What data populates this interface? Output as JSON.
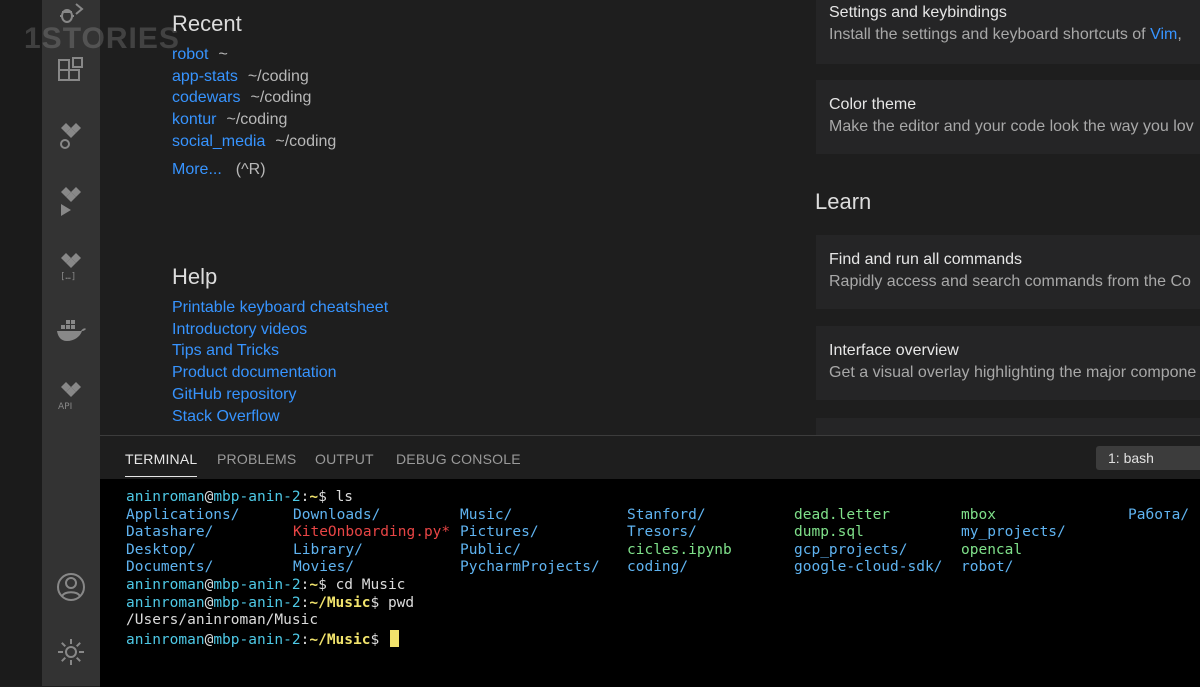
{
  "watermark": "1STORIES",
  "recent": {
    "title": "Recent",
    "items": [
      {
        "name": "robot",
        "path": "~"
      },
      {
        "name": "app-stats",
        "path": "~/coding"
      },
      {
        "name": "codewars",
        "path": "~/coding"
      },
      {
        "name": "kontur",
        "path": "~/coding"
      },
      {
        "name": "social_media",
        "path": "~/coding"
      }
    ],
    "more_label": "More...",
    "more_hint": "(^R)"
  },
  "help": {
    "title": "Help",
    "links": [
      "Printable keyboard cheatsheet",
      "Introductory videos",
      "Tips and Tricks",
      "Product documentation",
      "GitHub repository",
      "Stack Overflow"
    ]
  },
  "customize": {
    "cards": [
      {
        "title": "Settings and keybindings",
        "desc": "Install the settings and keyboard shortcuts of ",
        "link": "Vim",
        "after": ","
      },
      {
        "title": "Color theme",
        "desc": "Make the editor and your code look the way you lov"
      }
    ]
  },
  "learn": {
    "title": "Learn",
    "cards": [
      {
        "title": "Find and run all commands",
        "desc": "Rapidly access and search commands from the Co"
      },
      {
        "title": "Interface overview",
        "desc": "Get a visual overlay highlighting the major compone"
      }
    ]
  },
  "panel": {
    "tabs": [
      "TERMINAL",
      "PROBLEMS",
      "OUTPUT",
      "DEBUG CONSOLE"
    ],
    "active_tab": "TERMINAL",
    "shell": "1: bash"
  },
  "terminal": {
    "user": "aninroman",
    "host": "mbp-anin-2",
    "prompts": [
      {
        "path": "~",
        "cmd": "ls"
      },
      {
        "path": "~",
        "cmd": "cd Music"
      },
      {
        "path": "~/Music",
        "cmd": "pwd"
      },
      {
        "path": "~/Music",
        "cmd": ""
      }
    ],
    "ls_rows": [
      [
        [
          "Applications/",
          "blue"
        ],
        [
          "Downloads/",
          "blue"
        ],
        [
          "Music/",
          "blue"
        ],
        [
          "Stanford/",
          "blue"
        ],
        [
          "dead.letter",
          "green"
        ],
        [
          "mbox",
          "green"
        ],
        [
          "Работа/",
          "blue"
        ]
      ],
      [
        [
          "Datashare/",
          "blue"
        ],
        [
          "KiteOnboarding.py*",
          "red"
        ],
        [
          "Pictures/",
          "blue"
        ],
        [
          "Tresors/",
          "blue"
        ],
        [
          "dump.sql",
          "green"
        ],
        [
          "my_projects/",
          "blue"
        ],
        [
          "",
          ""
        ]
      ],
      [
        [
          "Desktop/",
          "blue"
        ],
        [
          "Library/",
          "blue"
        ],
        [
          "Public/",
          "blue"
        ],
        [
          "cicles.ipynb",
          "green"
        ],
        [
          "gcp_projects/",
          "blue"
        ],
        [
          "opencal",
          "green"
        ],
        [
          "",
          ""
        ]
      ],
      [
        [
          "Documents/",
          "blue"
        ],
        [
          "Movies/",
          "blue"
        ],
        [
          "PycharmProjects/",
          "blue"
        ],
        [
          "coding/",
          "blue"
        ],
        [
          "google-cloud-sdk/",
          "blue"
        ],
        [
          "robot/",
          "blue"
        ],
        [
          "",
          ""
        ]
      ]
    ],
    "pwd_output": "/Users/aninroman/Music"
  },
  "colors": {
    "link": "#3794ff",
    "prompt_path": "#f1e36c",
    "user": "#4ec9e6",
    "dir": "#5fb3f0",
    "file": "#7fe08a",
    "exec": "#e84545"
  }
}
